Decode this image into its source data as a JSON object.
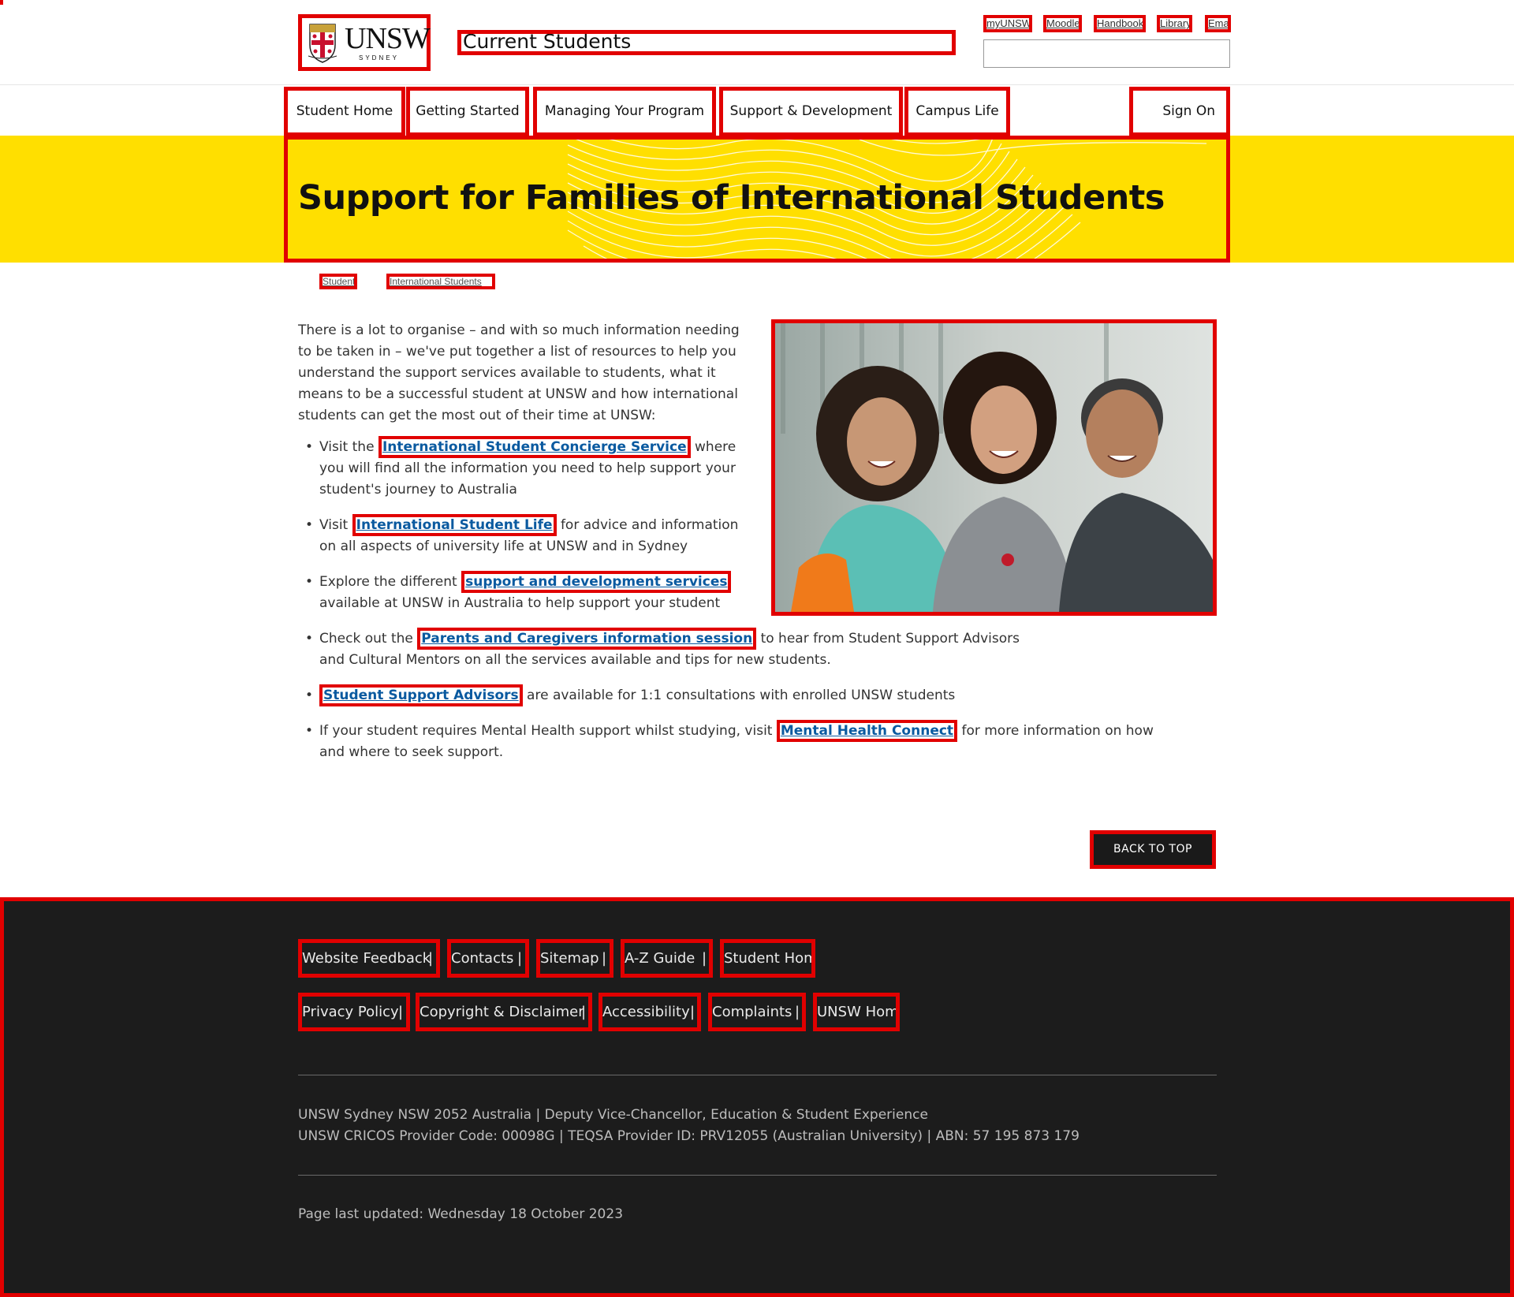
{
  "header": {
    "logo": {
      "word": "UNSW",
      "sub": "SYDNEY"
    },
    "site_title": "Current Students",
    "util_links": [
      "myUNSW",
      "Moodle",
      "Handbook",
      "Library",
      "Email"
    ],
    "search": {
      "placeholder": ""
    }
  },
  "nav": {
    "items": [
      "Student Home",
      "Getting Started",
      "Managing Your Program",
      "Support & Development",
      "Campus Life"
    ],
    "sign_on": "Sign On"
  },
  "banner": {
    "title": "Support for Families of International Students",
    "color": "#ffdf00"
  },
  "breadcrumb": [
    "Student",
    "International Students"
  ],
  "content": {
    "intro": "There is a lot to organise – and with so much information needing to be taken in – we've put together a list of resources to help you understand the support services available to students, what it means to be a successful student at UNSW and how international students can get the most out of their time at UNSW:",
    "bullets": [
      {
        "before": "Visit the ",
        "link": "International Student Concierge Service",
        "after": " where you will find all the information you need to help support your student's journey to Australia"
      },
      {
        "before": "Visit ",
        "link": "International Student Life",
        "after": " for advice and information on all aspects of university life at UNSW and in Sydney"
      },
      {
        "before": "Explore the different ",
        "link": "support and development services",
        "after": " available at UNSW in Australia to help support your student"
      },
      {
        "before": "Check out the ",
        "link": "Parents and Caregivers information session",
        "after": " to hear from Student Support Advisors and Cultural Mentors on all the services available and tips for new students."
      },
      {
        "before": "",
        "link": "Student Support Advisors",
        "after": " are available for 1:1 consultations with enrolled UNSW students"
      },
      {
        "before": "If your student requires Mental Health support whilst studying, visit ",
        "link": "Mental Health Connect",
        "after": " for more information on how and where to seek support."
      }
    ],
    "back_to_top": "BACK TO TOP"
  },
  "footer": {
    "row1": [
      "Website Feedback",
      "Contacts",
      "Sitemap",
      "A-Z Guide",
      "Student Home"
    ],
    "row2": [
      "Privacy Policy",
      "Copyright & Disclaimer",
      "Accessibility",
      "Complaints",
      "UNSW Home"
    ],
    "separator": "|",
    "address_line1": "UNSW Sydney NSW 2052 Australia | Deputy Vice-Chancellor, Education & Student Experience",
    "address_line2": "UNSW CRICOS Provider Code: 00098G | TEQSA Provider ID: PRV12055 (Australian University) | ABN: 57 195 873 179",
    "last_updated": "Page last updated: Wednesday 18 October 2023"
  },
  "colors": {
    "accent_red": "#e10000",
    "link_blue": "#0a5aa0",
    "footer_bg": "#1c1c1c"
  }
}
